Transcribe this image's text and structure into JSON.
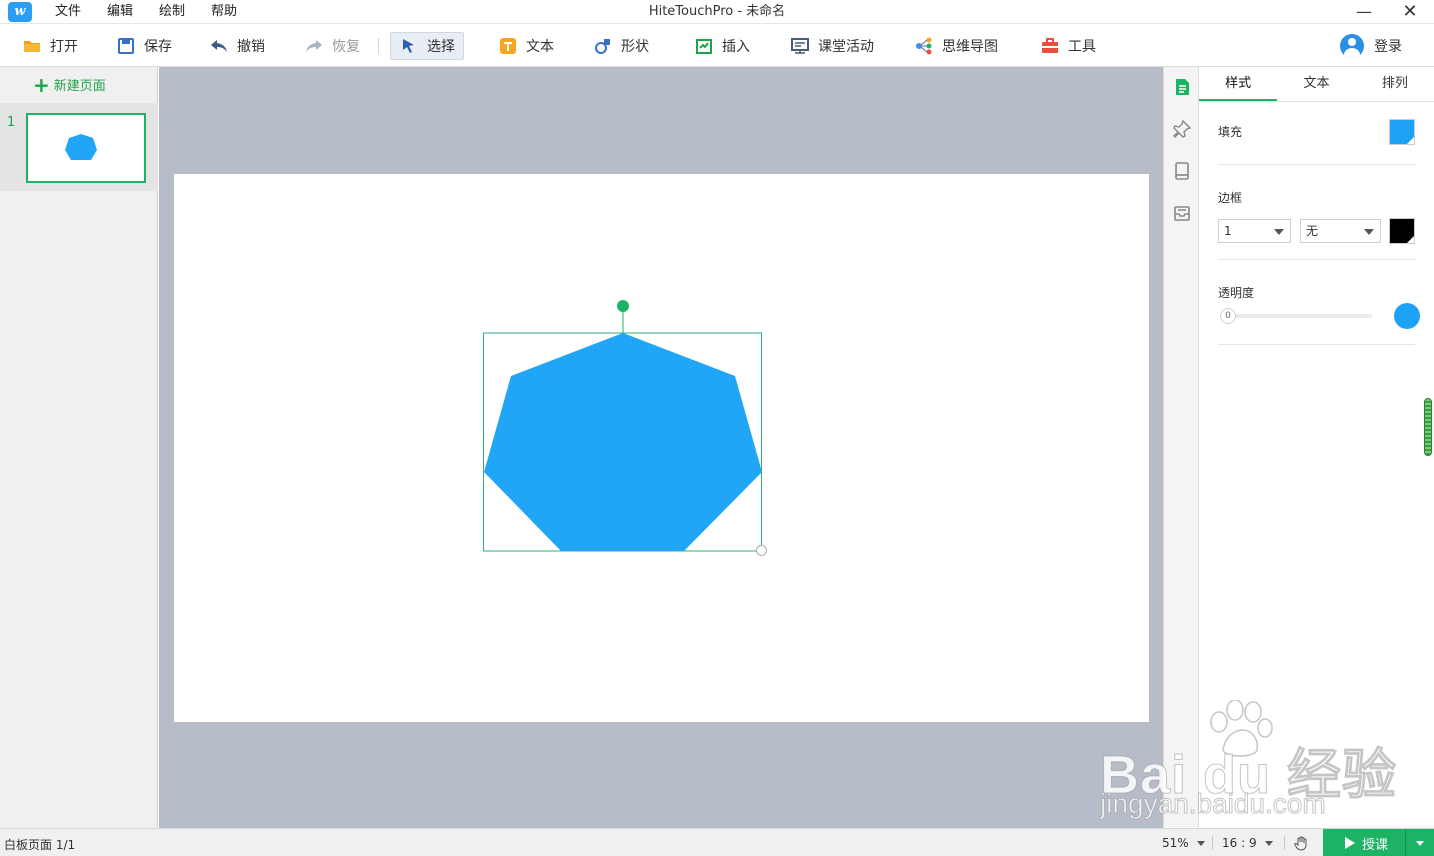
{
  "titlebar": {
    "title": "HiteTouchPro - 未命名",
    "menu": [
      "文件",
      "编辑",
      "绘制",
      "帮助"
    ],
    "logo_text": "w"
  },
  "toolbar": {
    "open": "打开",
    "save": "保存",
    "undo": "撤销",
    "redo": "恢复",
    "select": "选择",
    "text": "文本",
    "shape": "形状",
    "insert": "插入",
    "classroom": "课堂活动",
    "mindmap": "思维导图",
    "tools": "工具",
    "login": "登录"
  },
  "pages": {
    "new_page": "新建页面",
    "items": [
      {
        "number": "1"
      }
    ]
  },
  "props": {
    "tabs": [
      "样式",
      "文本",
      "排列"
    ],
    "fill_label": "填充",
    "fill_color": "#1fa2f5",
    "border_label": "边框",
    "border_width": "1",
    "border_style": "无",
    "border_color": "#000000",
    "opacity_label": "透明度",
    "opacity_value": "0"
  },
  "shape": {
    "type": "heptagon",
    "color": "#21a5f7"
  },
  "statusbar": {
    "page_info": "白板页面 1/1",
    "zoom": "51%",
    "ratio": "16 : 9",
    "teach": "授课"
  },
  "watermark": {
    "main": "Bai du 经验",
    "sub": "jingyan.baidu.com"
  },
  "colors": {
    "accent": "#1db364",
    "canvas_bg": "#b7bcc9"
  }
}
